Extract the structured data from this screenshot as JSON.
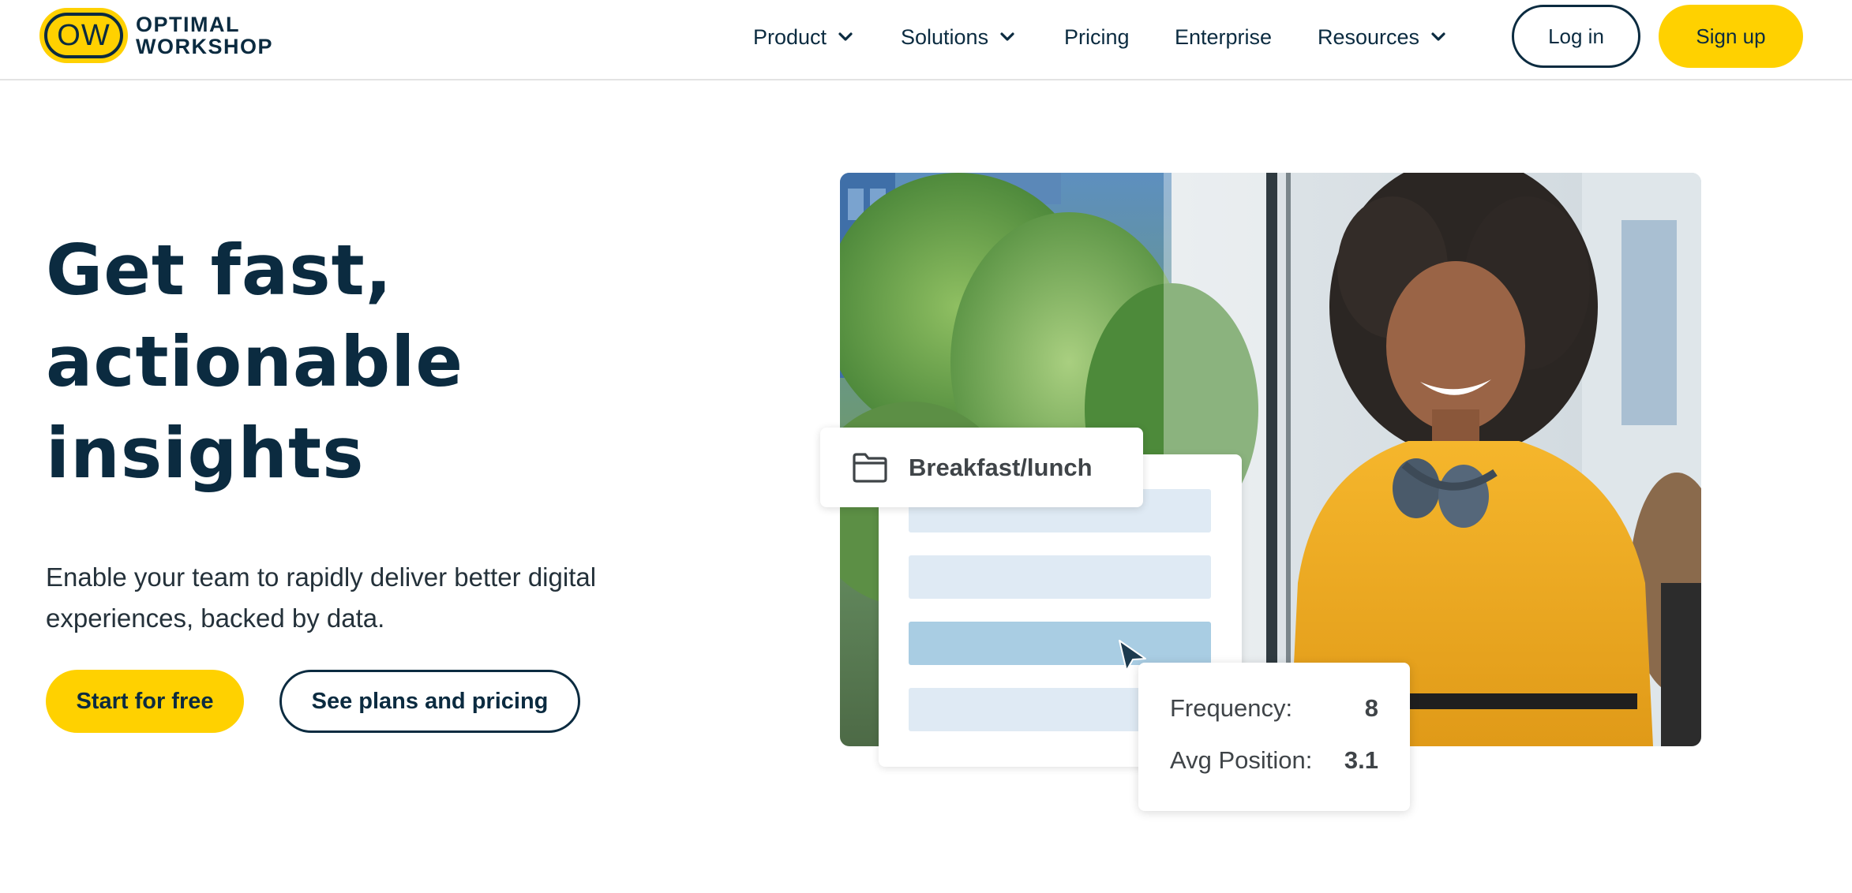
{
  "header": {
    "logo_badge": "OW",
    "logo_line1": "OPTIMAL",
    "logo_line2": "WORKSHOP",
    "nav": [
      {
        "label": "Product",
        "has_dropdown": true
      },
      {
        "label": "Solutions",
        "has_dropdown": true
      },
      {
        "label": "Pricing",
        "has_dropdown": false
      },
      {
        "label": "Enterprise",
        "has_dropdown": false
      },
      {
        "label": "Resources",
        "has_dropdown": true
      }
    ],
    "login_label": "Log in",
    "signup_label": "Sign up"
  },
  "hero": {
    "title_lines": [
      "Get fast,",
      "actionable",
      "insights"
    ],
    "subtitle": "Enable your team to rapidly deliver better digital experiences, backed by data.",
    "cta_primary": "Start for free",
    "cta_secondary": "See plans and pricing"
  },
  "visual": {
    "folder_label": "Breakfast/lunch",
    "stats": [
      {
        "label": "Frequency:",
        "value": "8"
      },
      {
        "label": "Avg Position:",
        "value": "3.1"
      }
    ],
    "list_rows": 4,
    "active_row": 3
  },
  "colors": {
    "brand_yellow": "#ffd100",
    "navy": "#0b2b40",
    "row_light": "#dfeaf4",
    "row_active": "#a9cde3"
  }
}
